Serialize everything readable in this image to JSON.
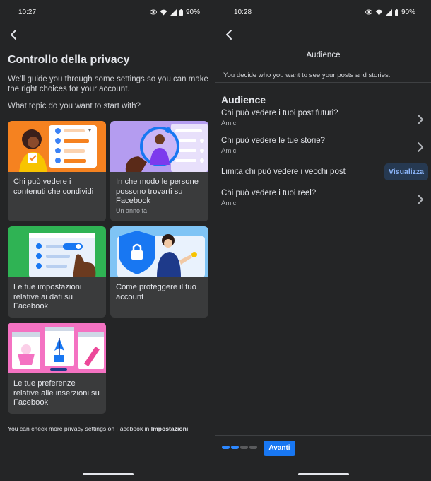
{
  "left": {
    "status": {
      "time": "10:27",
      "battery": "90%"
    },
    "back_icon": "chevron-left-icon",
    "title": "Controllo della privacy",
    "intro": "We'll guide you through some settings so you can make the right choices for your account.",
    "question": "What topic do you want to start with?",
    "cards": [
      {
        "label": "Chi può vedere i contenuti che condividi",
        "sub": ""
      },
      {
        "label": "In che modo le persone possono trovarti su Facebook",
        "sub": "Un anno fa"
      },
      {
        "label": "Le tue impostazioni relative ai dati su Facebook",
        "sub": ""
      },
      {
        "label": "Come proteggere il tuo account",
        "sub": ""
      },
      {
        "label": "Le tue preferenze relative alle inserzioni su Facebook",
        "sub": ""
      }
    ],
    "footer": {
      "text": "You can check more privacy settings on Facebook in ",
      "link": "Impostazioni"
    }
  },
  "right": {
    "status": {
      "time": "10:28",
      "battery": "90%"
    },
    "back_icon": "chevron-left-icon",
    "header": "Audience",
    "description": "You decide who you want to see your posts and stories.",
    "section_title": "Audience",
    "rows": [
      {
        "question": "Chi può vedere i tuoi post futuri?",
        "answer": "Amici"
      },
      {
        "question": "Chi può vedere le tue storie?",
        "answer": "Amici"
      },
      {
        "question": "Limita chi può vedere i vecchi post",
        "button": "Visualizza"
      },
      {
        "question": "Chi può vedere i tuoi reel?",
        "answer": "Amici"
      }
    ],
    "progress": {
      "steps": 4,
      "completed": 2
    },
    "next_label": "Avanti"
  },
  "colors": {
    "background": "#242526",
    "card": "#3a3b3c",
    "accent": "#1877f2",
    "card_art": [
      "#f58220",
      "#b49cf0",
      "#2fb354",
      "#7fc4f5",
      "#f472c2"
    ]
  }
}
